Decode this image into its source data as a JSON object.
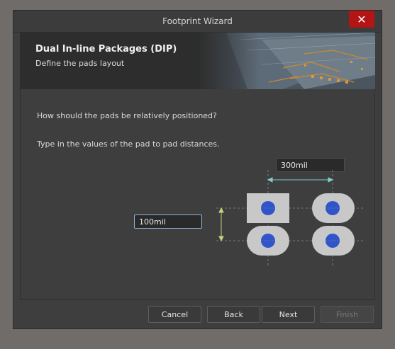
{
  "window": {
    "title": "Footprint Wizard",
    "close_glyph": "✕"
  },
  "header": {
    "title": "Dual In-line Packages (DIP)",
    "subtitle": "Define the pads layout"
  },
  "content": {
    "question": "How should the pads be relatively positioned?",
    "instruction": "Type in the values of the pad to pad distances.",
    "horizontal_distance": "300mil",
    "vertical_distance": "100mil"
  },
  "buttons": {
    "cancel": "Cancel",
    "back": "Back",
    "next": "Next",
    "finish": "Finish"
  },
  "colors": {
    "pad": "#c8c8c8",
    "hole": "#2f55c8",
    "dimension_horizontal": "#7fd0c8",
    "dimension_vertical": "#c8d27a",
    "close_button": "#b31414"
  }
}
